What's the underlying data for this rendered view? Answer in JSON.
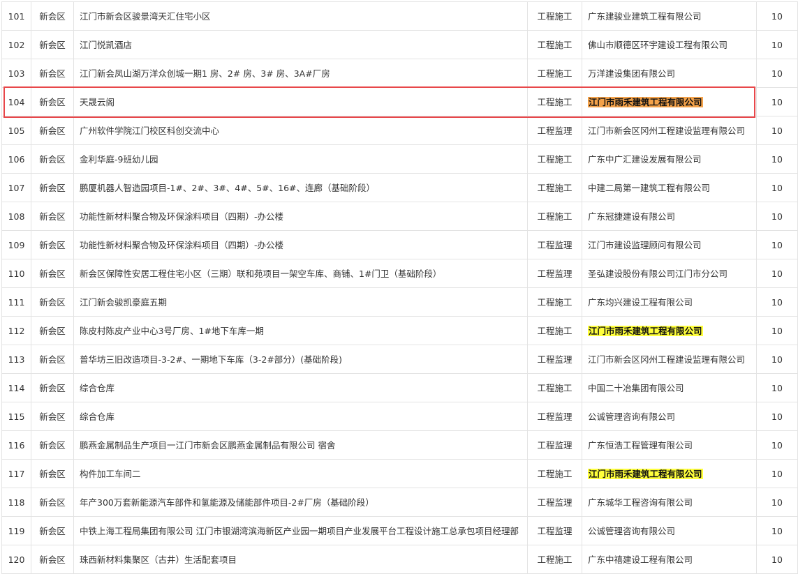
{
  "highlight_colors": {
    "orange": "#f4a24a",
    "yellow": "#ffff3c",
    "box": "#e8474a"
  },
  "rows": [
    {
      "no": "101",
      "district": "新会区",
      "project": "江门市新会区骏景湾天汇住宅小区",
      "type": "工程施工",
      "company": "广东建骏业建筑工程有限公司",
      "score": "10",
      "hl": ""
    },
    {
      "no": "102",
      "district": "新会区",
      "project": "江门悦凯酒店",
      "type": "工程施工",
      "company": "佛山市顺德区环宇建设工程有限公司",
      "score": "10",
      "hl": ""
    },
    {
      "no": "103",
      "district": "新会区",
      "project": "江门新会凤山湖万洋众创城一期1 房、2# 房、3# 房、3A#厂房",
      "type": "工程施工",
      "company": "万洋建设集团有限公司",
      "score": "10",
      "hl": ""
    },
    {
      "no": "104",
      "district": "新会区",
      "project": "天晟云阁",
      "type": "工程施工",
      "company": "江门市雨禾建筑工程有限公司",
      "score": "10",
      "hl": "orange"
    },
    {
      "no": "105",
      "district": "新会区",
      "project": "广州软件学院江门校区科创交流中心",
      "type": "工程监理",
      "company": "江门市新会区冈州工程建设监理有限公司",
      "score": "10",
      "hl": ""
    },
    {
      "no": "106",
      "district": "新会区",
      "project": "金利华庭-9班幼儿园",
      "type": "工程施工",
      "company": "广东中广汇建设发展有限公司",
      "score": "10",
      "hl": ""
    },
    {
      "no": "107",
      "district": "新会区",
      "project": "鹏厦机器人智造园项目-1#、2#、3#、4#、5#、16#、连廊（基础阶段）",
      "type": "工程施工",
      "company": "中建二局第一建筑工程有限公司",
      "score": "10",
      "hl": ""
    },
    {
      "no": "108",
      "district": "新会区",
      "project": "功能性新材料聚合物及环保涂料项目（四期）-办公楼",
      "type": "工程施工",
      "company": "广东冠捷建设有限公司",
      "score": "10",
      "hl": ""
    },
    {
      "no": "109",
      "district": "新会区",
      "project": "功能性新材料聚合物及环保涂料项目（四期）-办公楼",
      "type": "工程监理",
      "company": "江门市建设监理顾问有限公司",
      "score": "10",
      "hl": ""
    },
    {
      "no": "110",
      "district": "新会区",
      "project": "新会区保障性安居工程住宅小区（三期）联和苑项目一架空车库、商铺、1#门卫（基础阶段）",
      "type": "工程监理",
      "company": "圣弘建设股份有限公司江门市分公司",
      "score": "10",
      "hl": ""
    },
    {
      "no": "111",
      "district": "新会区",
      "project": "江门新会骏凯豪庭五期",
      "type": "工程施工",
      "company": "广东均兴建设工程有限公司",
      "score": "10",
      "hl": ""
    },
    {
      "no": "112",
      "district": "新会区",
      "project": "陈皮村陈皮产业中心3号厂房、1#地下车库一期",
      "type": "工程施工",
      "company": "江门市雨禾建筑工程有限公司",
      "score": "10",
      "hl": "yellow"
    },
    {
      "no": "113",
      "district": "新会区",
      "project": "普华坊三旧改造项目-3-2#、一期地下车库（3-2#部分）(基础阶段)",
      "type": "工程监理",
      "company": "江门市新会区冈州工程建设监理有限公司",
      "score": "10",
      "hl": ""
    },
    {
      "no": "114",
      "district": "新会区",
      "project": "综合仓库",
      "type": "工程施工",
      "company": "中国二十冶集团有限公司",
      "score": "10",
      "hl": ""
    },
    {
      "no": "115",
      "district": "新会区",
      "project": "综合仓库",
      "type": "工程监理",
      "company": "公诚管理咨询有限公司",
      "score": "10",
      "hl": ""
    },
    {
      "no": "116",
      "district": "新会区",
      "project": "鹏燕金属制品生产项目一江门市新会区鹏燕金属制品有限公司 宿舍",
      "type": "工程监理",
      "company": "广东恒浩工程管理有限公司",
      "score": "10",
      "hl": ""
    },
    {
      "no": "117",
      "district": "新会区",
      "project": "构件加工车间二",
      "type": "工程施工",
      "company": "江门市雨禾建筑工程有限公司",
      "score": "10",
      "hl": "yellow"
    },
    {
      "no": "118",
      "district": "新会区",
      "project": "年产300万套新能源汽车部件和氢能源及储能部件项目-2#厂房（基础阶段）",
      "type": "工程监理",
      "company": "广东城华工程咨询有限公司",
      "score": "10",
      "hl": ""
    },
    {
      "no": "119",
      "district": "新会区",
      "project": "中铁上海工程局集团有限公司 江门市银湖湾滨海新区产业园一期项目产业发展平台工程设计施工总承包项目经理部",
      "type": "工程监理",
      "company": "公诚管理咨询有限公司",
      "score": "10",
      "hl": ""
    },
    {
      "no": "120",
      "district": "新会区",
      "project": "珠西新材料集聚区（古井）生活配套项目",
      "type": "工程施工",
      "company": "广东中禧建设工程有限公司",
      "score": "10",
      "hl": ""
    }
  ]
}
